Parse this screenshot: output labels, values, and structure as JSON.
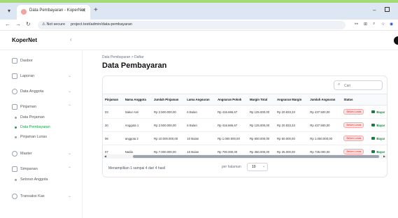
{
  "browser": {
    "tab_title": "Data Pembayaran - KoperNet",
    "tab_close": "✕",
    "new_tab": "+",
    "security_label": "⚠ Not secure",
    "url": "project.test/admin/data-pembayaran"
  },
  "app": {
    "brand": "KoperNet",
    "collapse_icon": "‹"
  },
  "sidebar": {
    "dasbor": "Dasbor",
    "laporan": "Laporan",
    "data_anggota": "Data Anggota",
    "pinjaman": "Pinjaman",
    "pinjaman_sub": [
      "Data Pinjaman",
      "Data Pembayaran",
      "Pinjaman Lunas"
    ],
    "master": "Master",
    "simpanan": "Simpanan",
    "simpanan_sub": [
      "Setoran Anggota"
    ],
    "transaksi_kas": "Transaksi Kas"
  },
  "main": {
    "breadcrumb": "Data Pembayaran  >  Daftar",
    "title": "Data Pembayaran",
    "search_placeholder": "Cari"
  },
  "table": {
    "headers": [
      "Pinjaman",
      "Nama Anggota",
      "Jumlah Pinjaman",
      "Lama Angsuran",
      "Angsuran Pokok",
      "Margin Total",
      "Angsuran Margin",
      "Jumlah Angsuran",
      "Status",
      ""
    ],
    "rows": [
      [
        "03",
        "Sakur Asri",
        "Rp 2.500.000,00",
        "6 Bulan",
        "Rp 416.666,67",
        "Rp 125.000,00",
        "Rp 20.833,33",
        "Rp 437.500,00",
        "Belum Lunas",
        "Bayar"
      ],
      [
        "20",
        "Anggota 1",
        "Rp 2.500.000,00",
        "6 Bulan",
        "Rp 416.666,67",
        "Rp 125.000,00",
        "Rp 20.833,33",
        "Rp 437.500,00",
        "Belum Lunas",
        "Bayar"
      ],
      [
        "06",
        "anggota 2",
        "Rp 10.000.000,00",
        "10 Bulan",
        "Rp 1.000.000,00",
        "Rp 500.000,00",
        "Rp 50.000,00",
        "Rp 1.050.000,00",
        "Belum Lunas",
        "Bayar"
      ],
      [
        "07",
        "Nadia",
        "Rp 7.000.000,00",
        "10 Bulan",
        "Rp 700.000,00",
        "Rp 350.000,00",
        "Rp 35.000,00",
        "Rp 735.000,00",
        "Belum Lunas",
        "Bayar"
      ]
    ]
  },
  "footer": {
    "summary": "Menampilkan 1 sampai 4 dari 4 hasil",
    "per_page_label": "per halaman",
    "per_page_value": "10"
  },
  "colors": {
    "accent": "#16a34a",
    "status_unpaid": "#dc2626",
    "top_strip": "#a3d977"
  }
}
